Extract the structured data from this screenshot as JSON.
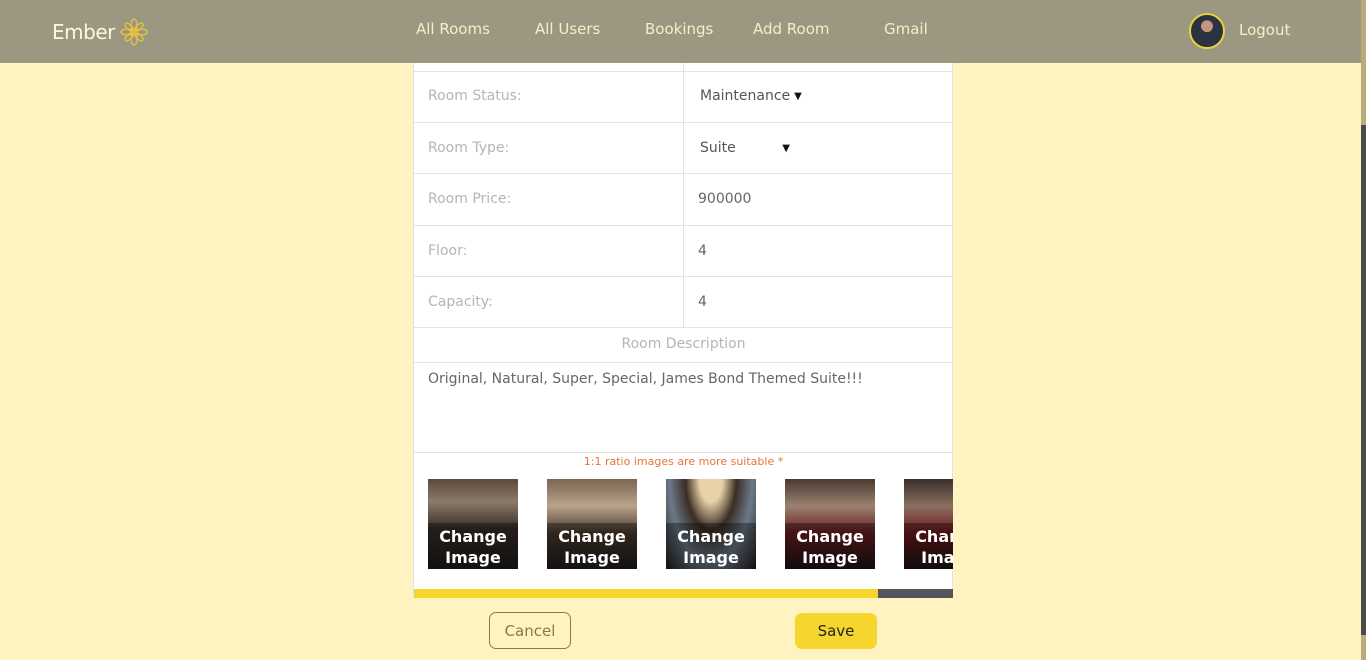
{
  "navbar": {
    "brand": "Ember",
    "links": [
      "All Rooms",
      "All Users",
      "Bookings",
      "Add Room",
      "Gmail"
    ],
    "logout": "Logout",
    "logo_icon": "lotus-icon"
  },
  "form": {
    "status_label": "Room Status:",
    "status_value": "Maintenance",
    "type_label": "Room Type:",
    "type_value": "Suite",
    "price_label": "Room Price:",
    "price_value": "900000",
    "floor_label": "Floor:",
    "floor_value": "4",
    "capacity_label": "Capacity:",
    "capacity_value": "4",
    "description_heading": "Room Description",
    "description_value": "Original, Natural, Super, Special, James Bond Themed Suite!!!",
    "image_hint": "1:1 ratio images are more suitable *",
    "images": [
      {
        "caption": "Change Image"
      },
      {
        "caption": "Change Image"
      },
      {
        "caption": "Change Image"
      },
      {
        "caption": "Change Image"
      },
      {
        "caption": "Change Image"
      }
    ],
    "gallery_scroll_fraction": 0.86
  },
  "actions": {
    "cancel": "Cancel",
    "save": "Save"
  },
  "colors": {
    "background": "#fff3c2",
    "navbar": "#9c9780",
    "accent": "#f6d62e",
    "hint": "#e8743b"
  }
}
